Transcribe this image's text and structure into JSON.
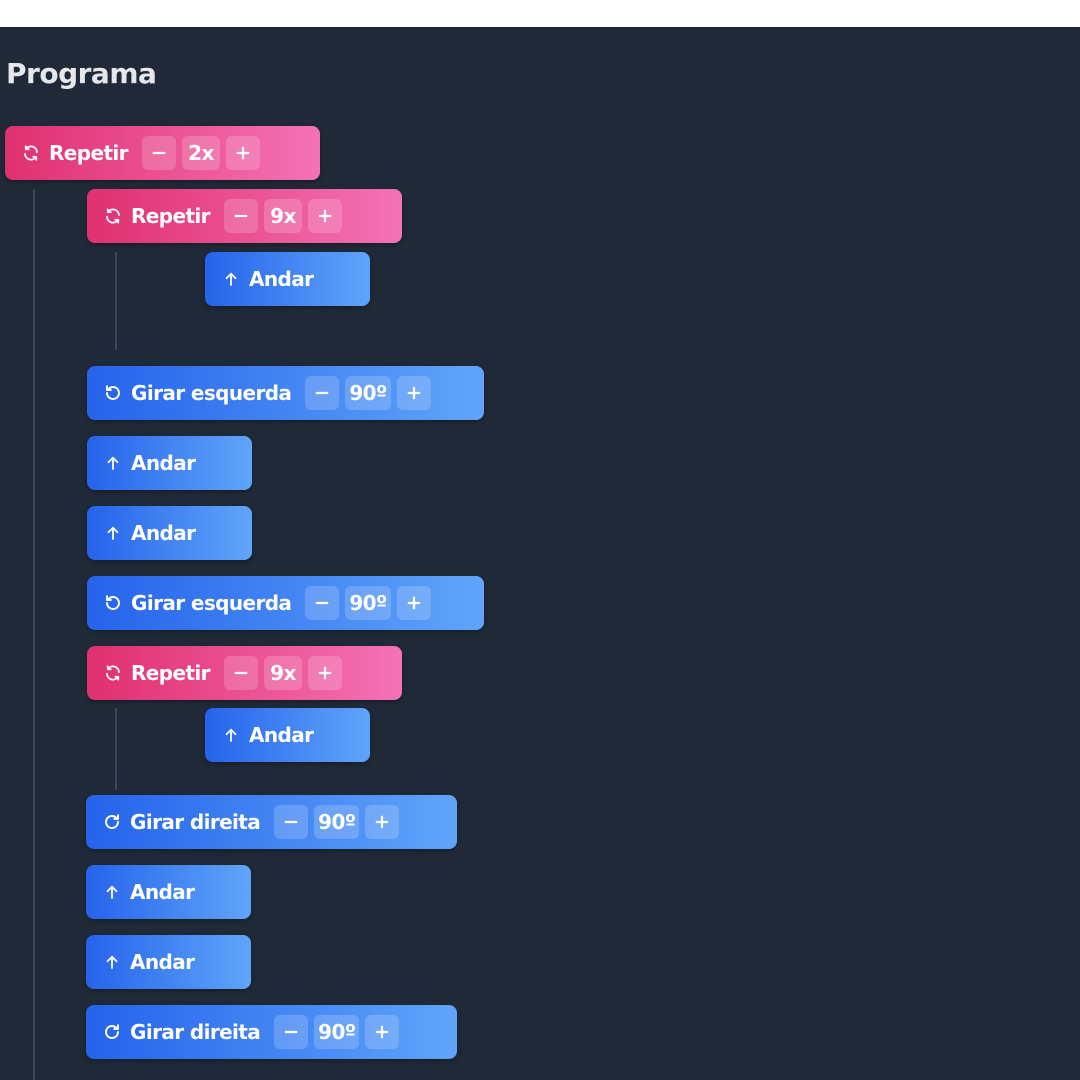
{
  "panel": {
    "title": "Programa"
  },
  "blocks": [
    {
      "kind": "loop",
      "icon": "repeat-icon",
      "label": "Repetir",
      "value": "2x"
    },
    {
      "kind": "loop",
      "icon": "repeat-icon",
      "label": "Repetir",
      "value": "9x"
    },
    {
      "kind": "cmd",
      "icon": "arrow-up-icon",
      "label": "Andar"
    },
    {
      "kind": "cmd",
      "icon": "rotate-left-icon",
      "label": "Girar esquerda",
      "value": "90º"
    },
    {
      "kind": "cmd",
      "icon": "arrow-up-icon",
      "label": "Andar"
    },
    {
      "kind": "cmd",
      "icon": "arrow-up-icon",
      "label": "Andar"
    },
    {
      "kind": "cmd",
      "icon": "rotate-left-icon",
      "label": "Girar esquerda",
      "value": "90º"
    },
    {
      "kind": "loop",
      "icon": "repeat-icon",
      "label": "Repetir",
      "value": "9x"
    },
    {
      "kind": "cmd",
      "icon": "arrow-up-icon",
      "label": "Andar"
    },
    {
      "kind": "cmd",
      "icon": "rotate-right-icon",
      "label": "Girar direita",
      "value": "90º"
    },
    {
      "kind": "cmd",
      "icon": "arrow-up-icon",
      "label": "Andar"
    },
    {
      "kind": "cmd",
      "icon": "arrow-up-icon",
      "label": "Andar"
    },
    {
      "kind": "cmd",
      "icon": "rotate-right-icon",
      "label": "Girar direita",
      "value": "90º"
    }
  ],
  "colors": {
    "background": "#1f2937",
    "loop_block": "#e0306f",
    "command_block": "#2563eb"
  }
}
